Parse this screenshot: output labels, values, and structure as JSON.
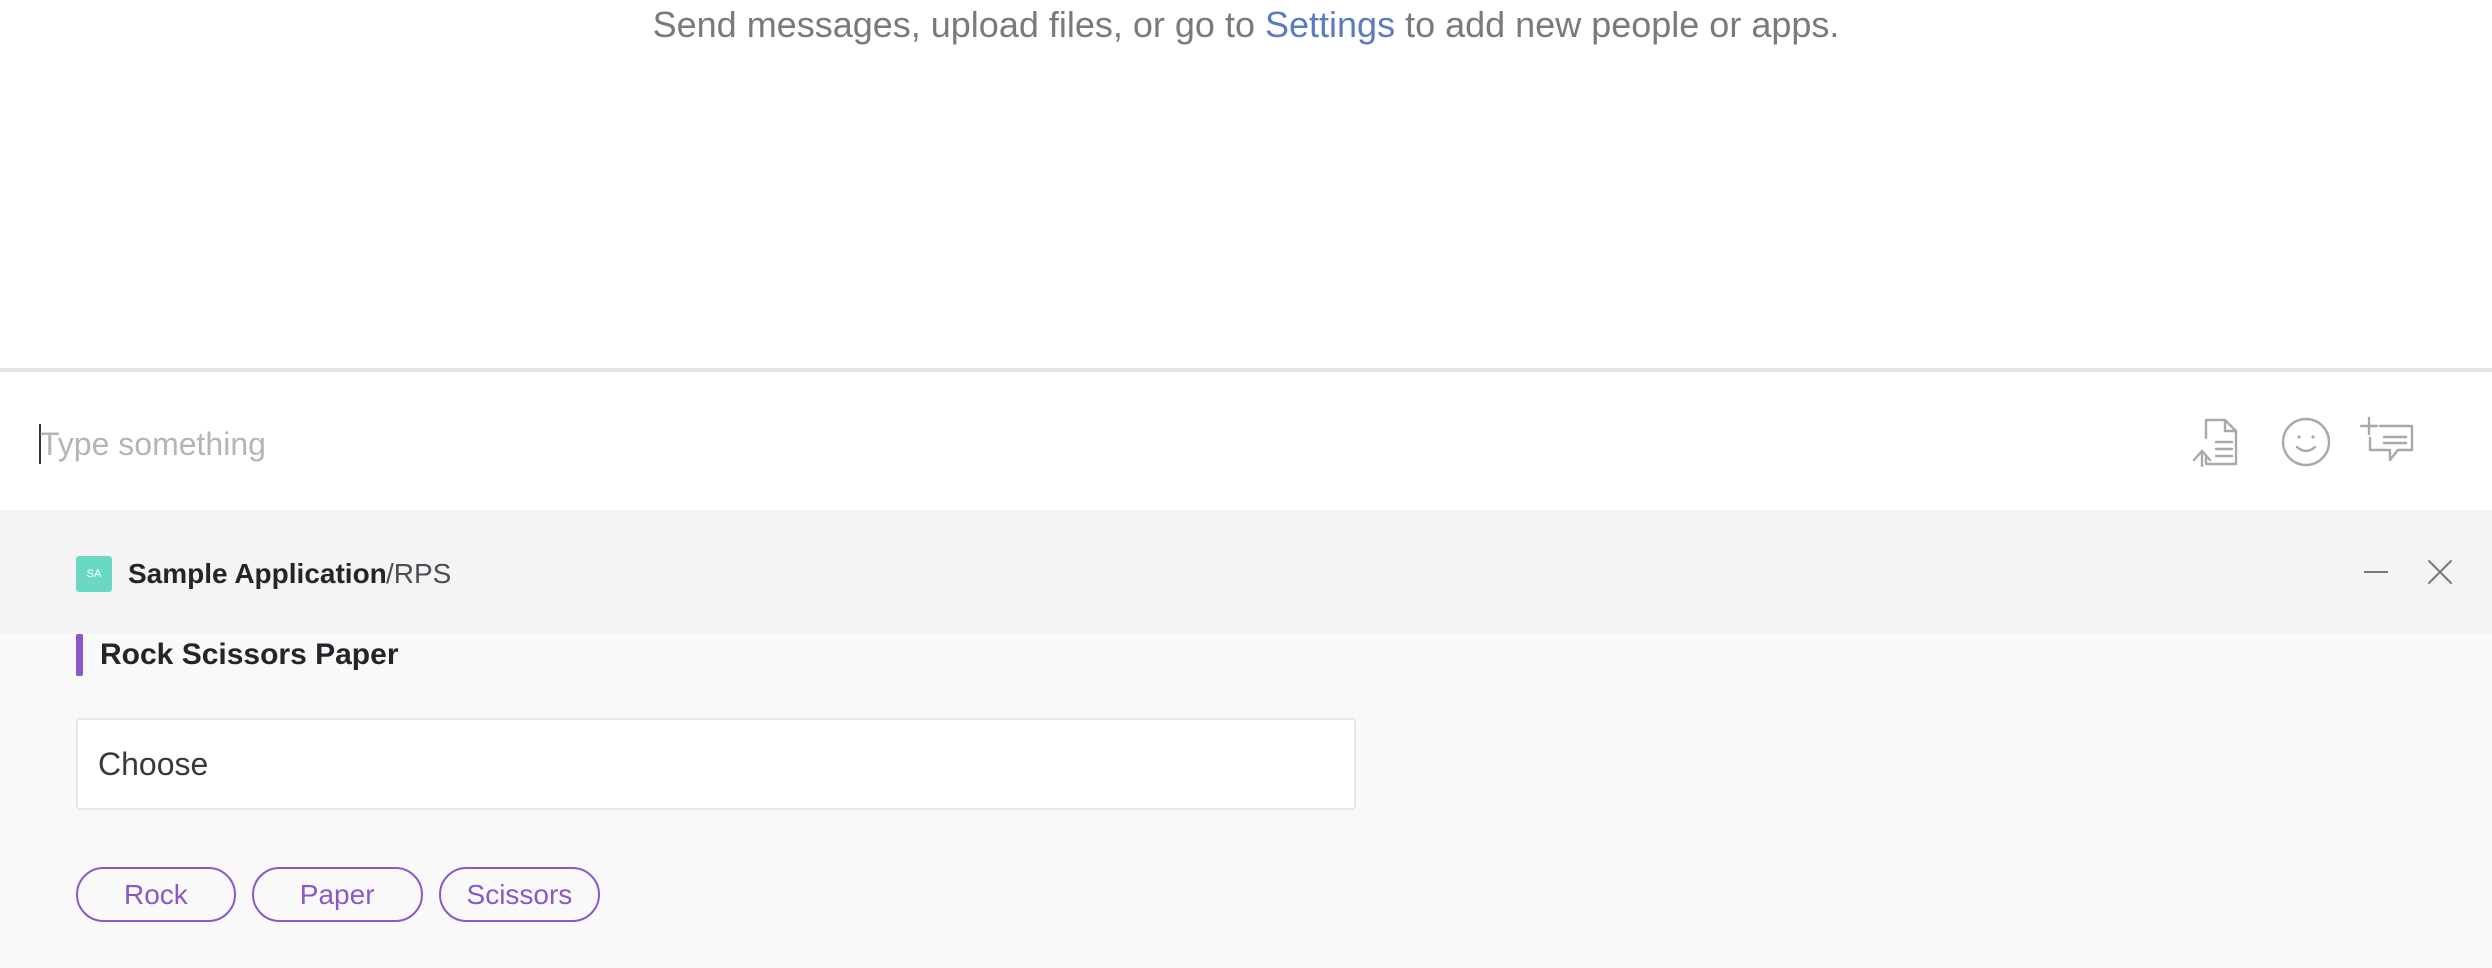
{
  "info_line": {
    "before_link": "Send messages, upload files, or go to ",
    "link": "Settings",
    "after_link": " to add new people or apps."
  },
  "composer": {
    "placeholder": "Type something",
    "icons": [
      "upload-file-icon",
      "emoji-icon",
      "add-chat-icon"
    ]
  },
  "app": {
    "logo_text": "SA",
    "name": "Sample Application",
    "command": "/RPS",
    "card_title": "Rock Scissors Paper",
    "choose_label": "Choose",
    "choices": [
      "Rock",
      "Paper",
      "Scissors"
    ],
    "accent_color": "#8b58c8",
    "logo_color": "#6ad9c2"
  },
  "colors": {
    "link": "#5b7cc4",
    "panel_background": "#f9f9f9",
    "header_background": "#f4f4f4"
  }
}
